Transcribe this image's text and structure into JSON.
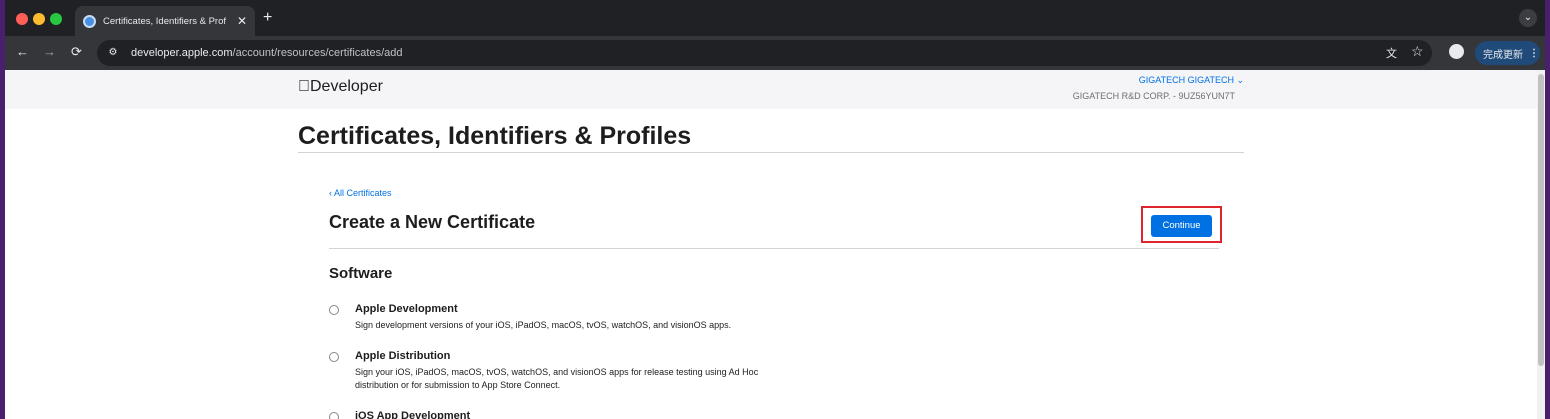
{
  "browser": {
    "tab_title": "Certificates, Identifiers & Prof",
    "tab_close": "✕",
    "new_tab": "+",
    "tab_menu": "⌄",
    "url_host": "developer.apple.com",
    "url_path": "/account/resources/certificates/add",
    "update_label": "完成更新",
    "update_menu": "⋮"
  },
  "header": {
    "logo": "Developer",
    "account_name": "GIGATECH GIGATECH ⌄",
    "team": "GIGATECH R&D CORP. - 9UZ56YUN7T"
  },
  "main": {
    "page_title": "Certificates, Identifiers & Profiles",
    "back_link": "‹ All Certificates",
    "section_title": "Create a New Certificate",
    "continue_label": "Continue",
    "group_title": "Software",
    "options": [
      {
        "title": "Apple Development",
        "desc": "Sign development versions of your iOS, iPadOS, macOS, tvOS, watchOS, and visionOS apps.",
        "desc2": ""
      },
      {
        "title": "Apple Distribution",
        "desc": "Sign your iOS, iPadOS, macOS, tvOS, watchOS, and visionOS apps for release testing using Ad Hoc",
        "desc2": "distribution or for submission to App Store Connect."
      },
      {
        "title": "iOS App Development",
        "desc": "",
        "desc2": ""
      }
    ]
  },
  "colors": {
    "accent": "#0071e3",
    "highlight": "#e0242b"
  }
}
